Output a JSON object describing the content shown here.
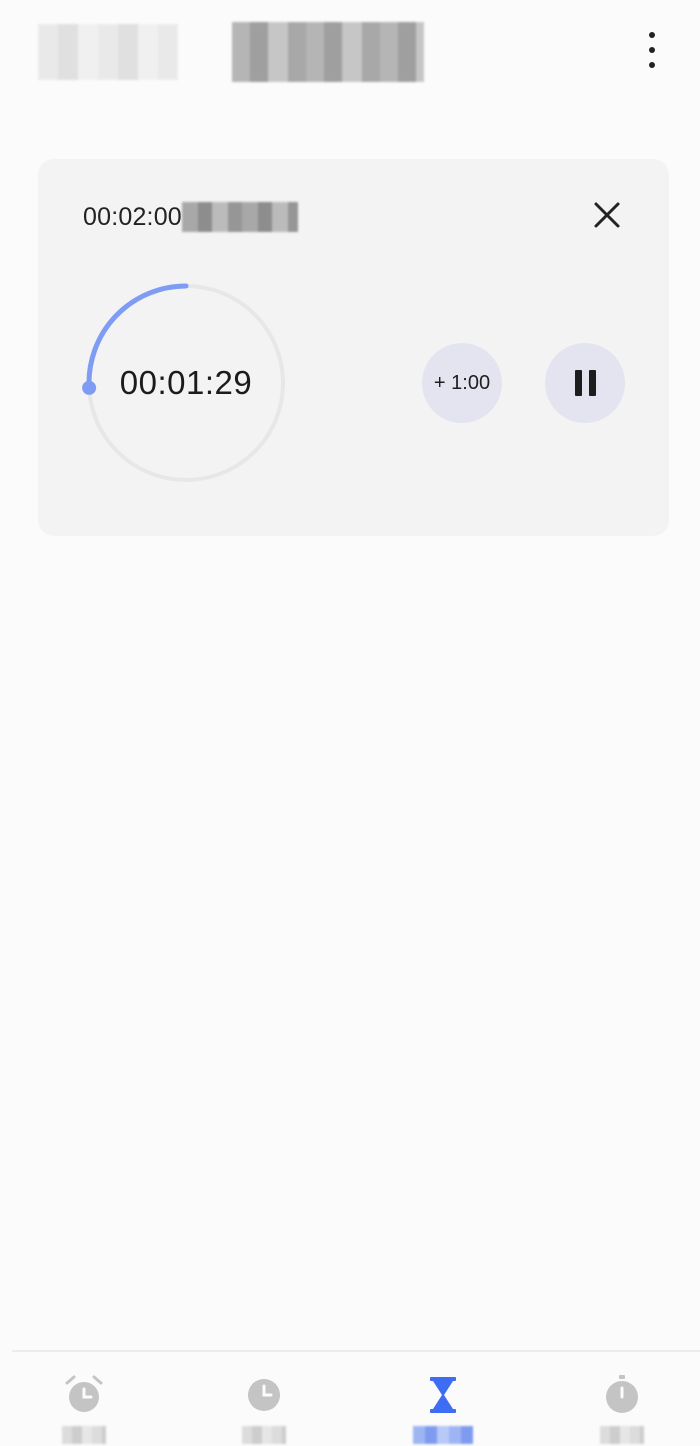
{
  "header": {
    "icon": "more-vert-icon"
  },
  "timer": {
    "total_duration": "00:02:00",
    "remaining": "00:01:29",
    "progress_elapsed_fraction": 0.258,
    "add_minute_label": "+ 1:00",
    "pause_icon": "pause-icon",
    "close_icon": "close-icon"
  },
  "colors": {
    "accent": "#7f9cf5",
    "card_bg": "#f3f3f3",
    "button_bg": "#e4e4f1",
    "nav_active": "#3d6df2",
    "nav_inactive": "#c4c4c4"
  },
  "bottom_nav": {
    "items": [
      {
        "icon": "alarm-icon",
        "active": false
      },
      {
        "icon": "clock-icon",
        "active": false
      },
      {
        "icon": "hourglass-icon",
        "active": true
      },
      {
        "icon": "stopwatch-icon",
        "active": false
      }
    ]
  }
}
